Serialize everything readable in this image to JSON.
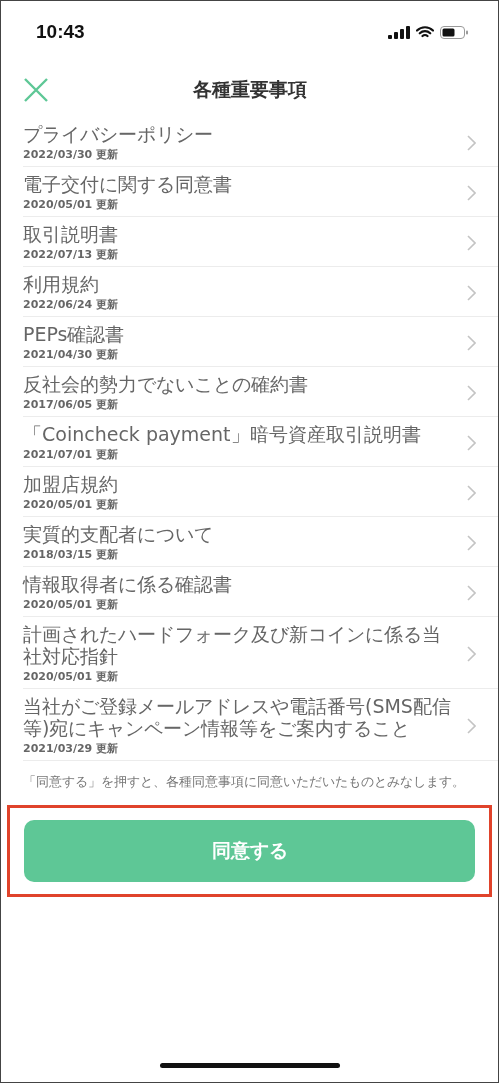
{
  "status_bar": {
    "time": "10:43"
  },
  "header": {
    "title": "各種重要事項"
  },
  "documents": [
    {
      "title": "プライバシーポリシー",
      "updated": "2022/03/30 更新"
    },
    {
      "title": "電子交付に関する同意書",
      "updated": "2020/05/01 更新"
    },
    {
      "title": "取引説明書",
      "updated": "2022/07/13 更新"
    },
    {
      "title": "利用規約",
      "updated": "2022/06/24 更新"
    },
    {
      "title": "PEPs確認書",
      "updated": "2021/04/30 更新"
    },
    {
      "title": "反社会的勢力でないことの確約書",
      "updated": "2017/06/05 更新"
    },
    {
      "title": "「Coincheck payment」暗号資産取引説明書",
      "updated": "2021/07/01 更新"
    },
    {
      "title": "加盟店規約",
      "updated": "2020/05/01 更新"
    },
    {
      "title": "実質的支配者について",
      "updated": "2018/03/15 更新"
    },
    {
      "title": "情報取得者に係る確認書",
      "updated": "2020/05/01 更新"
    },
    {
      "title": "計画されたハードフォーク及び新コインに係る当社対応指針",
      "updated": "2020/05/01 更新"
    },
    {
      "title": "当社がご登録メールアドレスや電話番号(SMS配信等)宛にキャンペーン情報等をご案内すること",
      "updated": "2021/03/29 更新"
    }
  ],
  "notice": "「同意する」を押すと、各種同意事項に同意いただいたものとみなします。",
  "agree_button": {
    "label": "同意する"
  }
}
